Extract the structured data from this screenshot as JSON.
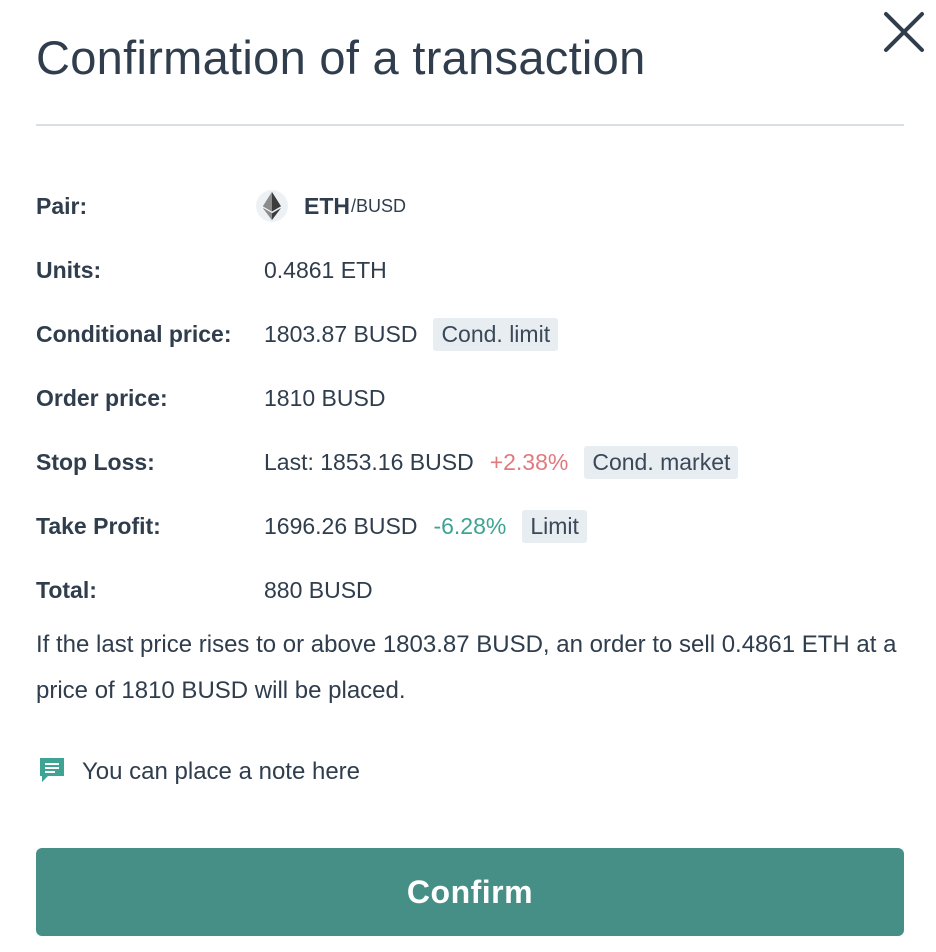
{
  "modal": {
    "title": "Confirmation of a transaction",
    "close_icon": "close-icon"
  },
  "details": {
    "pair": {
      "label": "Pair:",
      "base": "ETH",
      "quote": "/BUSD",
      "icon": "ethereum-icon"
    },
    "units": {
      "label": "Units:",
      "value": "0.4861 ETH"
    },
    "conditional_price": {
      "label": "Conditional price:",
      "value": "1803.87 BUSD",
      "tag": "Cond. limit"
    },
    "order_price": {
      "label": "Order price:",
      "value": "1810 BUSD"
    },
    "stop_loss": {
      "label": "Stop Loss:",
      "value": "Last: 1853.16 BUSD",
      "change": "+2.38%",
      "tag": "Cond. market"
    },
    "take_profit": {
      "label": "Take Profit:",
      "value": "1696.26 BUSD",
      "change": "-6.28%",
      "tag": "Limit"
    },
    "total": {
      "label": "Total:",
      "value": "880 BUSD"
    }
  },
  "description": "If the last price rises to or above 1803.87 BUSD, an order to sell 0.4861 ETH at a price of 1810 BUSD will be placed.",
  "note": {
    "icon": "comment-icon",
    "text": "You can place a note here"
  },
  "confirm_button": {
    "label": "Confirm"
  },
  "colors": {
    "accent": "#458f86",
    "negative_change": "#e07a7f",
    "positive_change": "#3ea393",
    "tag_background": "#e8edf1",
    "text": "#2f3d4d"
  }
}
